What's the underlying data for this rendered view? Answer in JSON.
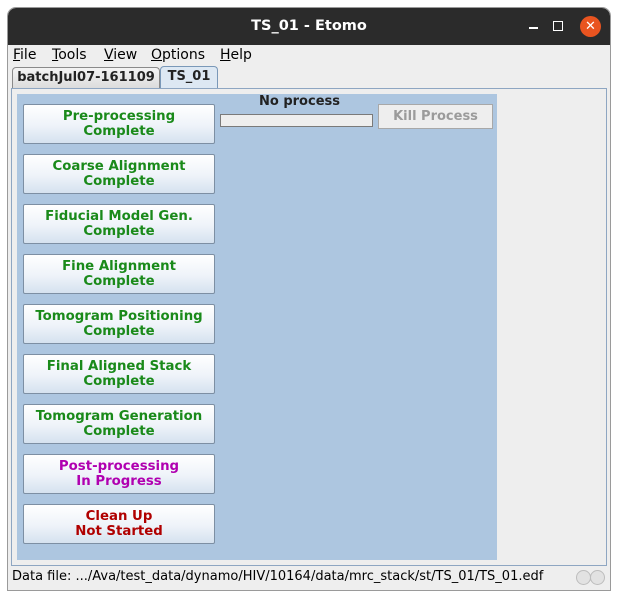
{
  "window": {
    "title": "TS_01 - Etomo"
  },
  "menu": [
    {
      "mnemonic": "F",
      "rest": "ile"
    },
    {
      "mnemonic": "T",
      "rest": "ools"
    },
    {
      "mnemonic": "V",
      "rest": "iew"
    },
    {
      "mnemonic": "O",
      "rest": "ptions"
    },
    {
      "mnemonic": "H",
      "rest": "elp"
    }
  ],
  "tabs": [
    {
      "label": "batchJul07-161109",
      "active": false
    },
    {
      "label": "TS_01",
      "active": true
    }
  ],
  "colors": {
    "complete": "#1a8a1a",
    "in_progress": "#b000b0",
    "not_started": "#b00000",
    "panel": "#adc6e0"
  },
  "steps": [
    {
      "name": "Pre-processing",
      "status": "Complete"
    },
    {
      "name": "Coarse Alignment",
      "status": "Complete"
    },
    {
      "name": "Fiducial Model Gen.",
      "status": "Complete"
    },
    {
      "name": "Fine Alignment",
      "status": "Complete"
    },
    {
      "name": "Tomogram Positioning",
      "status": "Complete"
    },
    {
      "name": "Final Aligned Stack",
      "status": "Complete"
    },
    {
      "name": "Tomogram Generation",
      "status": "Complete"
    },
    {
      "name": "Post-processing",
      "status": "In Progress"
    },
    {
      "name": "Clean Up",
      "status": "Not Started"
    }
  ],
  "process": {
    "label": "No process",
    "progress": 0,
    "kill_label": "Kill Process"
  },
  "status": {
    "text": "Data file: .../Ava/test_data/dynamo/HIV/10164/data/mrc_stack/st/TS_01/TS_01.edf"
  }
}
